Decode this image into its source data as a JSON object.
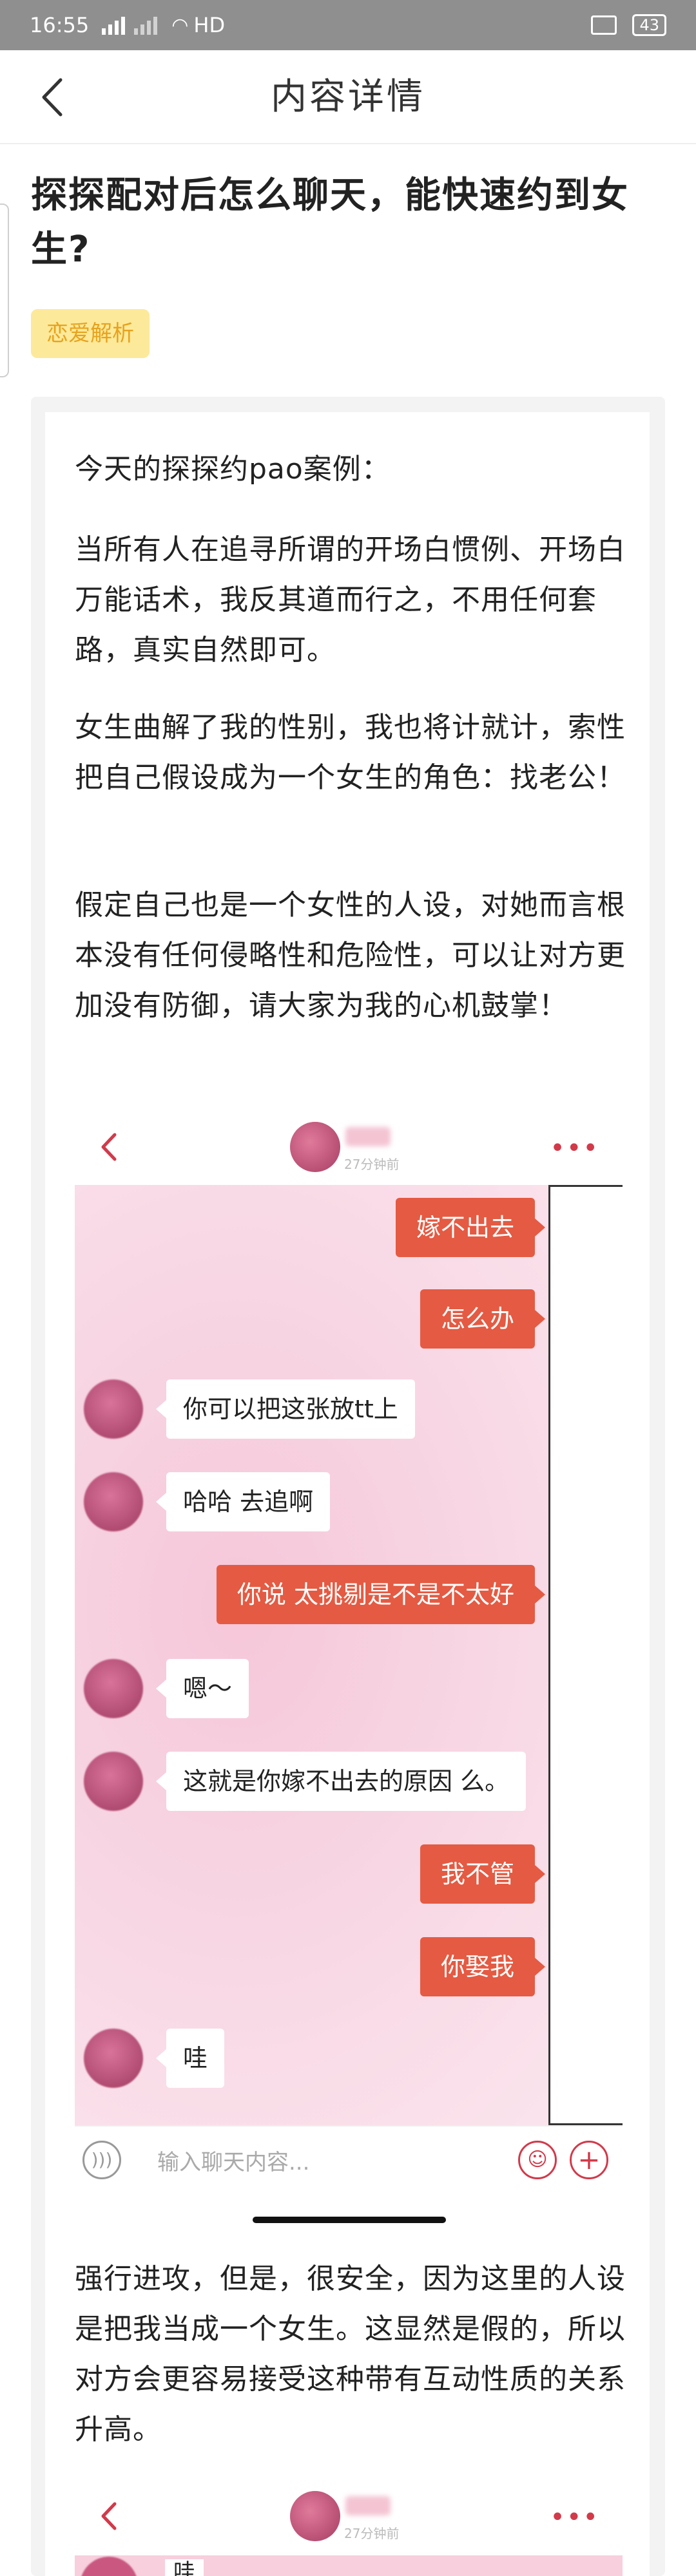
{
  "status_bar": {
    "time": "16:55",
    "sig1": "4G",
    "sig2": "3G",
    "network": "HD",
    "battery": "43"
  },
  "navbar": {
    "title": "内容详情"
  },
  "article": {
    "title": "探探配对后怎么聊天，能快速约到女生?",
    "tag": "恋爱解析",
    "paragraphs": [
      "今天的探探约pao案例：",
      "当所有人在追寻所谓的开场白惯例、开场白万能话术，我反其道而行之，不用任何套路，真实自然即可。",
      "女生曲解了我的性别，我也将计就计，索性把自己假设成为一个女生的角色：找老公！",
      "假定自己也是一个女性的人设，对她而言根本没有任何侵略性和危险性，可以让对方更加没有防御，请大家为我的心机鼓掌！",
      "强行进攻，但是，很安全，因为这里的人设是把我当成一个女生。这显然是假的，所以对方会更容易接受这种带有互动性质的关系升高。"
    ]
  },
  "chat": {
    "time_ago": "27分钟前",
    "input_placeholder": "输入聊天内容...",
    "messages": [
      {
        "side": "out",
        "text": "嫁不出去"
      },
      {
        "side": "out",
        "text": "怎么办"
      },
      {
        "side": "in",
        "text": "你可以把这张放tt上"
      },
      {
        "side": "in",
        "text": "哈哈  去追啊"
      },
      {
        "side": "out",
        "text": "你说 太挑剔是不是不太好"
      },
      {
        "side": "in",
        "text": "嗯～"
      },
      {
        "side": "in",
        "text": "这就是你嫁不出去的原因 么。"
      },
      {
        "side": "out",
        "text": "我不管"
      },
      {
        "side": "out",
        "text": "你娶我"
      },
      {
        "side": "in",
        "text": "哇"
      }
    ]
  },
  "chat2": {
    "time_ago": "27分钟前",
    "first_msg": "哇"
  }
}
